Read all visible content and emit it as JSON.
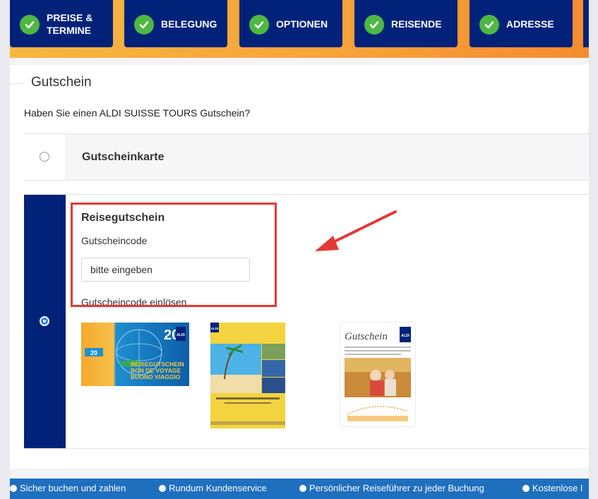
{
  "steps": [
    {
      "label_line1": "PREISE &",
      "label_line2": "TERMINE",
      "icon": "check-icon"
    },
    {
      "label_line1": "BELEGUNG",
      "label_line2": "",
      "icon": "check-icon"
    },
    {
      "label_line1": "OPTIONEN",
      "label_line2": "",
      "icon": "check-icon"
    },
    {
      "label_line1": "REISENDE",
      "label_line2": "",
      "icon": "check-icon"
    },
    {
      "label_line1": "ADRESSE",
      "label_line2": "",
      "icon": "check-icon"
    }
  ],
  "section": {
    "title": "Gutschein",
    "question": "Haben Sie einen ALDI SUISSE TOURS Gutschein?"
  },
  "options": {
    "gift_card": {
      "label": "Gutscheinkarte",
      "selected": false
    },
    "travel_voucher": {
      "label": "Reisegutschein",
      "selected": true,
      "code_label": "Gutscheincode",
      "code_placeholder": "bitte eingeben",
      "redeem_link": "Gutscheincode einlösen"
    }
  },
  "thumbnails": {
    "voucher1": {
      "value": "20",
      "currency_badge": "20",
      "brand": "ALDI",
      "lines": [
        "REISEGUTSCHEIN",
        "BON DE VOYAGE",
        "BUONO VIAGGIO"
      ]
    },
    "voucher2": {
      "brand": "ALDI"
    },
    "voucher3": {
      "title": "Gutschein",
      "brand": "ALDI"
    }
  },
  "ribbon": [
    "Sicher buchen und zahlen",
    "Rundum Kundenservice",
    "Persönlicher Reiseführer zu jeder Buchung",
    "Kostenlose I"
  ],
  "colors": {
    "brand_navy": "#02227a",
    "accent_orange": "#f7a13a",
    "check_green": "#4eb843",
    "highlight_red": "#e53935",
    "ribbon_blue": "#1f6fbf"
  }
}
